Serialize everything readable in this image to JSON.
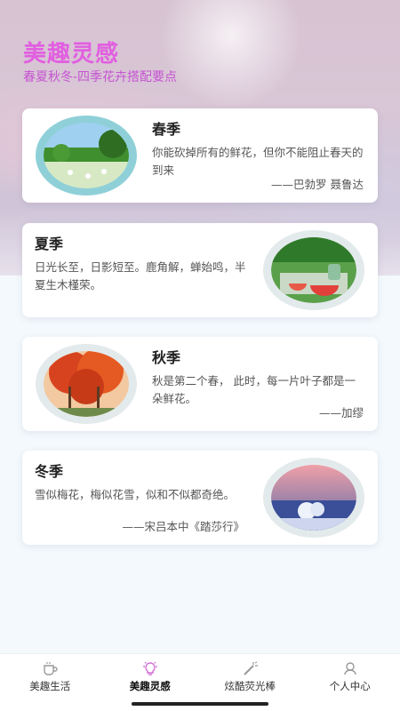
{
  "header": {
    "title": "美趣灵感",
    "subtitle": "春夏秋冬-四季花卉搭配要点"
  },
  "cards": [
    {
      "season": "春季",
      "quote": "你能砍掉所有的鲜花，但你不能阻止春天的到来",
      "author": "——巴勃罗 聂鲁达",
      "image_side": "left",
      "ring_color": "#8fd0d8"
    },
    {
      "season": "夏季",
      "quote": "日光长至，日影短至。鹿角解，蝉始鸣，半夏生木槿荣。",
      "author": "",
      "image_side": "right",
      "ring_color": "#e3eaec"
    },
    {
      "season": "秋季",
      "quote": "秋是第二个春， 此时，每一片叶子都是一朵鲜花。",
      "author": "——加缪",
      "image_side": "left",
      "ring_color": "#e3eaec"
    },
    {
      "season": "冬季",
      "quote": "雪似梅花，梅似花雪，似和不似都奇绝。",
      "author": "——宋吕本中《踏莎行》",
      "image_side": "right",
      "ring_color": "#e3eaec"
    }
  ],
  "tabbar": {
    "items": [
      {
        "label": "美趣生活",
        "icon": "cup-icon",
        "active": false
      },
      {
        "label": "美趣灵感",
        "icon": "lightbulb-icon",
        "active": true
      },
      {
        "label": "炫酷荧光棒",
        "icon": "glowstick-icon",
        "active": false
      },
      {
        "label": "个人中心",
        "icon": "user-icon",
        "active": false
      }
    ]
  },
  "colors": {
    "title": "#e15fe0",
    "active_icon": "#d06ad6"
  }
}
